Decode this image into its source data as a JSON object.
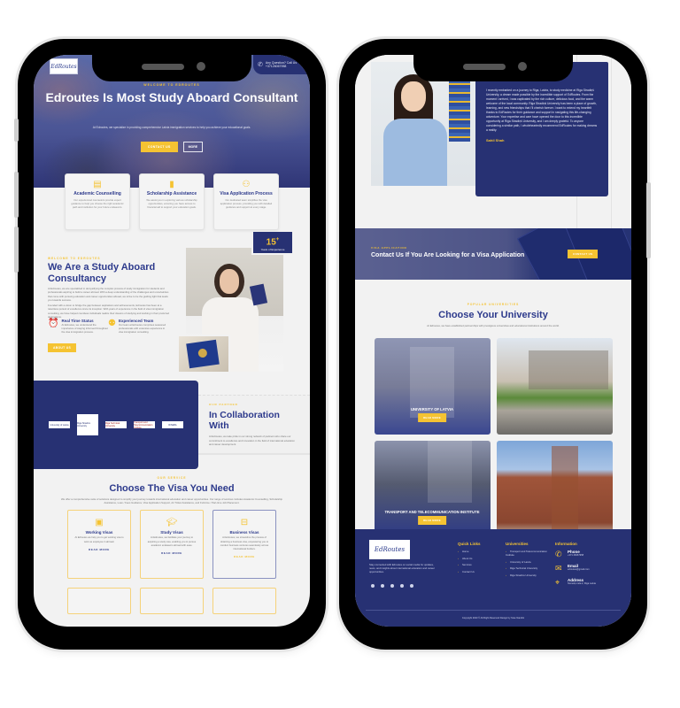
{
  "left_phone": {
    "header": {
      "logo_text": "EdRoutes",
      "call_label": "Any Question? Call Us",
      "call_number": "+37126067958"
    },
    "hero": {
      "eyebrow": "WELCOME TO EDROUTES",
      "title": "Edroutes Is Most Study Aboard Consultant",
      "subtitle": "At Edroutes, we specialize in providing comprehensive Latvia immigration services to help you achieve your educational goals.",
      "primary_button": "CONTACT US",
      "secondary_button": "MORE"
    },
    "features": [
      {
        "icon": "document-icon",
        "title": "Academic Counselling",
        "desc": "Our experienced counselors provide expert guidance to help you choose the right academic path and institution for your future endeavors."
      },
      {
        "icon": "book-icon",
        "title": "Scholarship Assistance",
        "desc": "We assist you in exploring various scholarship opportunities, ensuring you have access to financial aid to support your education goals."
      },
      {
        "icon": "users-icon",
        "title": "Visa Application Process",
        "desc": "Our dedicated team simplifies the visa application process, providing you with detailed guidance and support at every stage."
      }
    ],
    "about": {
      "eyebrow": "WELCOME TO EDROUTES",
      "title": "We Are a Study Aboard Consultancy",
      "paragraph1": "At Edroutes, we are specialized in demystifying the complex process of study immigration for students and professionals aspiring to build a career abroad. With a deep understanding of the challenges and uncertainties that come with pursuing education and career opportunities abroad, we strive to be the guiding light that leads you towards success.",
      "paragraph2": "Founded with a vision to bridge the gap between aspirations and achievements, Edroutes has been at a relentless pursuit of excellence since its inception. With years of experience in the field of visa immigration consulting, we have helped countless individuals realize their dreams of studying and working in their preferred destinations.",
      "badge_number": "15",
      "badge_sup": "+",
      "badge_label": "Years of Experience",
      "mini_features": [
        {
          "icon": "alarm-clock-icon",
          "title": "Real Time Status",
          "desc": "At Edroutes, we understand the importance of staying informed throughout the visa immigration process."
        },
        {
          "icon": "team-icon",
          "title": "Experienced Team",
          "desc": "Our team at Edroutes comprises seasoned professionals with extensive experience in visa immigration consulting."
        }
      ],
      "button": "ABOUT US"
    },
    "partners": {
      "logos": [
        "University of Latvia",
        "Riga Stradins University",
        "Riga Technical University",
        "Transport and Telecommunication Institute",
        "RISEBA"
      ],
      "eyebrow": "OUR PARTNER",
      "title": "In Collaboration With",
      "desc": "At Edroutes, we take pride in our strong network of partners who share our commitment to excellence and innovation in the field of international education and career development."
    },
    "visas": {
      "eyebrow": "OUR SERVICE",
      "title": "Choose The Visa You Need",
      "desc": "We offer a comprehensive suite of solutions designed to simplify your journey towards international education and career opportunities. Our range of services includes Academic Counselling, Scholarship Assistance, Loan / Fees Guidance, Visa Application Support, Air Ticket Assistance, and Full-time / Part-time Job Placement.",
      "cards": [
        {
          "icon": "briefcase-desk-icon",
          "title": "Working Visas",
          "desc": "At Edroutes we help you to get working visa to work as employee in abroad.",
          "link": "READ MORE",
          "active": false
        },
        {
          "icon": "graduation-cap-icon",
          "title": "Study Visas",
          "desc": "At Edroutes, we facilitate your journey to acquiring a study visa, enabling you to pursue academic endeavors abroad with ease.",
          "link": "READ MORE",
          "active": false
        },
        {
          "icon": "briefcase-icon",
          "title": "Business Visas",
          "desc": "At Edroutes, we streamline the process of obtaining a business visa, empowering you to conduct business ventures seamlessly across international borders.",
          "link": "READ MORE",
          "active": true
        }
      ]
    }
  },
  "right_phone": {
    "testimonial": {
      "quote": "I recently embarked on a journey to Riga, Latvia, to study medicine at Riga Stradiņš University, a dream made possible by the incredible support of EdRoutes. From the moment I arrived, I was captivated by the rich culture, delicious food, and the warm welcome of the local community. Riga Stradiņš University has been a place of growth, learning, and new friendships that I'll cherish forever. I want to extend my heartfelt thanks to EdRoutes for their guidance and support in navigating this life-changing adventure. Your expertise and care have opened the door to this incredible opportunity at Riga Stradiņš University, and I am deeply grateful. To anyone considering a similar path, I wholeheartedly recommend EdRoutes for making dreams a reality.",
      "author": "Sahil Shah"
    },
    "cta": {
      "eyebrow": "VISA APPLICATION",
      "title": "Contact Us If You Are Looking for a Visa Application",
      "button": "CONTACT US"
    },
    "universities": {
      "eyebrow": "POPULAR UNIVERSITIES",
      "title": "Choose Your University",
      "desc": "At Edroutes, we have established partnerships with prestigious universities and educational institutions around the world.",
      "cards": [
        {
          "name": "UNIVERSITY OF LATVIA",
          "button": "READ MORE",
          "show_label": true
        },
        {
          "name": "",
          "button": "",
          "show_label": false
        },
        {
          "name": "TRANSPORT AND TELECOMMUNICATION INSTITUTE",
          "button": "READ MORE",
          "show_label": true
        },
        {
          "name": "",
          "button": "",
          "show_label": false
        }
      ]
    },
    "footer": {
      "logo_text": "EdRoutes",
      "desc": "Stay connected with Edroutes on social media for updates, news, and insights about international education and career opportunities.",
      "quick_links_title": "Quick Links",
      "quick_links": [
        "Home",
        "About Us",
        "Services",
        "Contact Us"
      ],
      "universities_title": "Universities",
      "universities": [
        "Transport and Telecommunication Institute",
        "University of Latvia",
        "Riga Technical University",
        "Riga Stradins University"
      ],
      "info_title": "Information",
      "phone_label": "Phone",
      "phone_value": "+371 26067958",
      "email_label": "Email",
      "email_value": "edroutes@gmail.com",
      "address_label": "Address",
      "address_value": "Nometņu iela 2, Riga Latvia",
      "social": [
        "facebook-icon",
        "instagram-icon",
        "linkedin-icon",
        "whatsapp-icon",
        "youtube-icon"
      ],
      "copyright": "Copyright 2023 © All Right Reserved Design by Sree Nandini"
    }
  }
}
